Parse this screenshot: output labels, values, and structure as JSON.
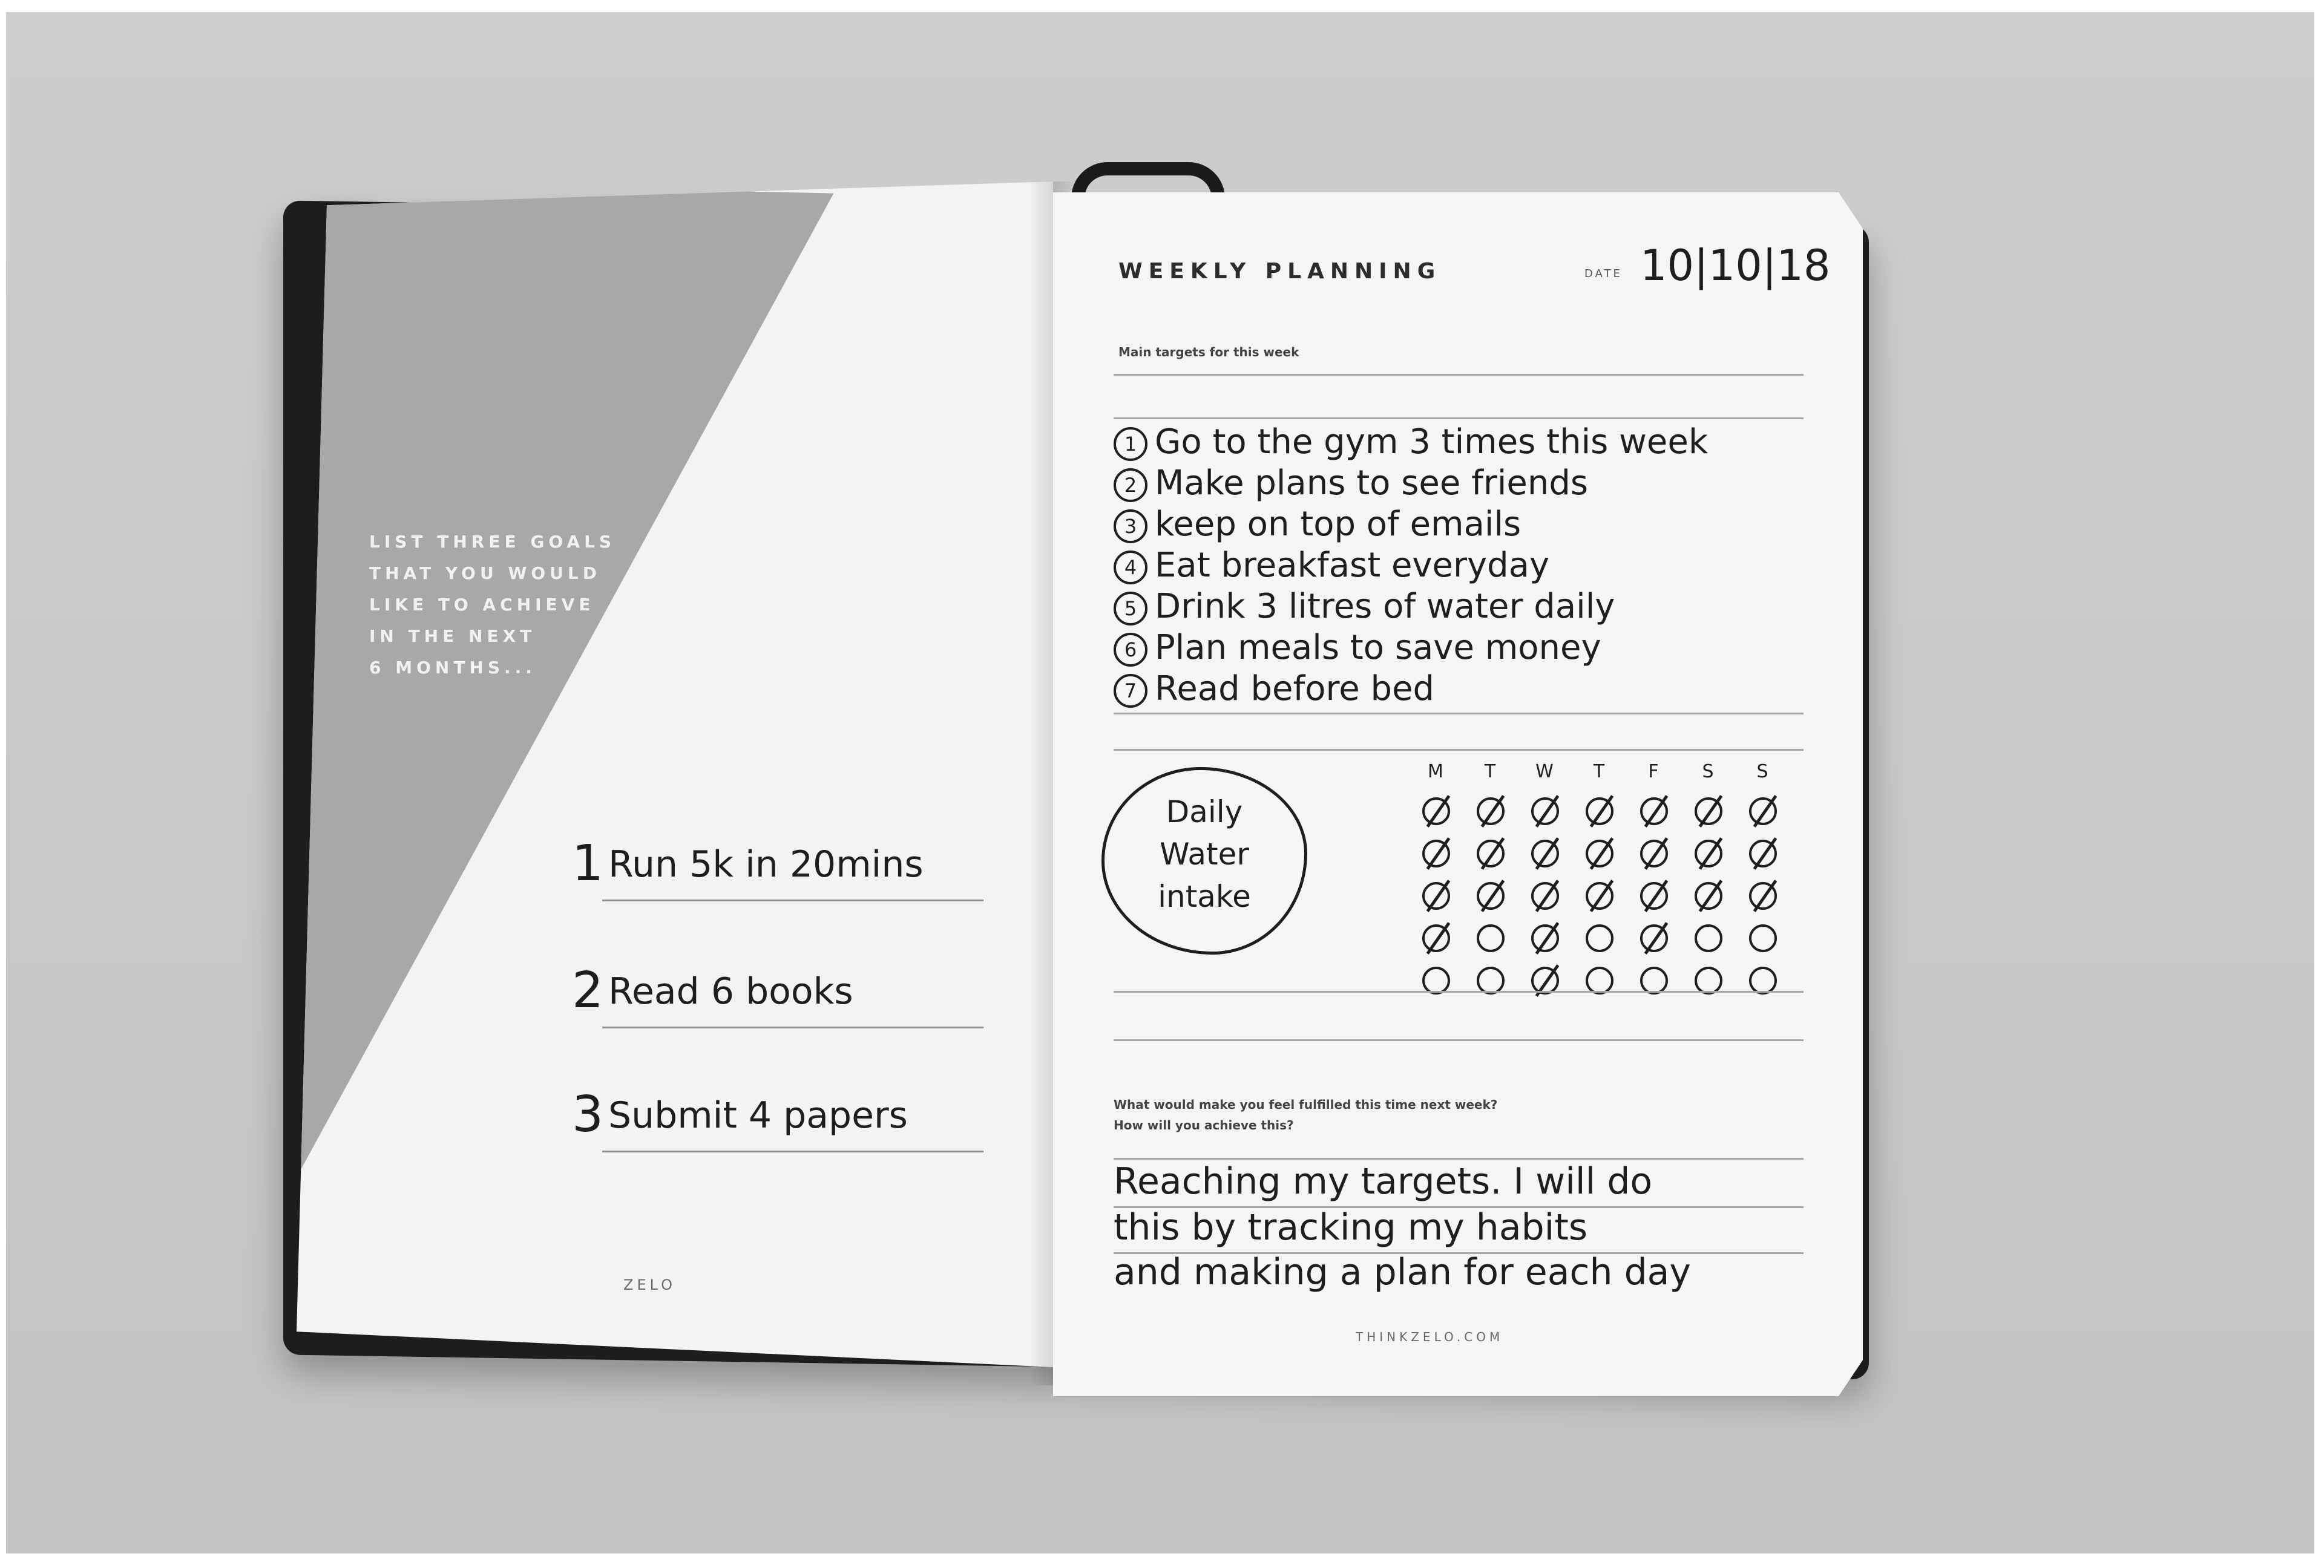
{
  "left_page": {
    "prompt_lines": [
      "LIST THREE GOALS",
      "THAT YOU WOULD",
      "LIKE TO ACHIEVE",
      "IN THE NEXT",
      "6 MONTHS..."
    ],
    "goals": [
      {
        "num": "1",
        "text": "Run 5k in 20mins"
      },
      {
        "num": "2",
        "text": "Read 6 books"
      },
      {
        "num": "3",
        "text": "Submit 4 papers"
      }
    ],
    "footer": "ZELO"
  },
  "right_page": {
    "title": "WEEKLY PLANNING",
    "date_label": "DATE",
    "date_value": "10|10|18",
    "targets_label": "Main targets for this week",
    "targets": [
      {
        "num": "1",
        "text": "Go to the gym 3 times this week"
      },
      {
        "num": "2",
        "text": "Make plans to see friends"
      },
      {
        "num": "3",
        "text": "keep on top of emails"
      },
      {
        "num": "4",
        "text": "Eat breakfast everyday"
      },
      {
        "num": "5",
        "text": "Drink 3 litres of water daily"
      },
      {
        "num": "6",
        "text": "Plan meals to save money"
      },
      {
        "num": "7",
        "text": "Read before bed"
      }
    ],
    "habit": {
      "label_lines": [
        "Daily",
        "Water",
        "intake"
      ],
      "days": [
        "M",
        "T",
        "W",
        "T",
        "F",
        "S",
        "S"
      ],
      "grid": [
        [
          1,
          1,
          1,
          1,
          1,
          1,
          1
        ],
        [
          1,
          1,
          1,
          1,
          1,
          1,
          1
        ],
        [
          1,
          1,
          1,
          1,
          1,
          1,
          1
        ],
        [
          1,
          0,
          1,
          0,
          1,
          0,
          0
        ],
        [
          0,
          0,
          1,
          0,
          0,
          0,
          0
        ]
      ]
    },
    "question_lines": [
      "What would make you feel fulfilled this time next week?",
      "How will you achieve this?"
    ],
    "answer_lines": [
      "Reaching my targets. I will do",
      "this by tracking my habits",
      "and making a plan for each day"
    ],
    "footer": "THINKZELO.COM"
  }
}
